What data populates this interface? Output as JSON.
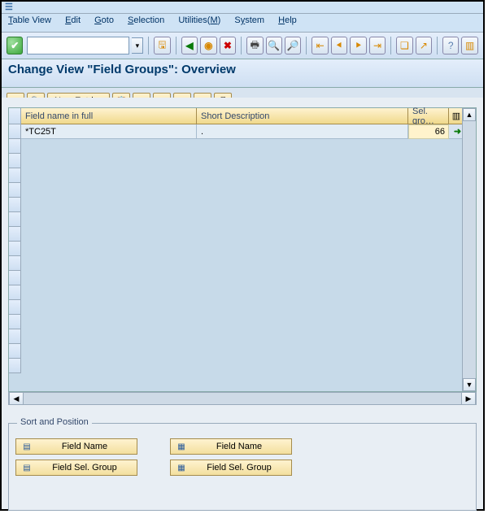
{
  "menu": {
    "table_view": "Table View",
    "edit": "Edit",
    "goto": "Goto",
    "selection": "Selection",
    "utilities": "Utilities(M)",
    "system": "System",
    "help": "Help"
  },
  "page_title": "Change View \"Field Groups\": Overview",
  "app_toolbar": {
    "new_entries": "New Entries"
  },
  "grid": {
    "columns": {
      "field_name": "Field name in full",
      "short_desc": "Short Description",
      "sel_grp": "Sel. gro…"
    },
    "rows": [
      {
        "field_name": "*TC25T",
        "short_desc": ".",
        "sel_grp": "66"
      }
    ]
  },
  "sort_panel": {
    "legend": "Sort and Position",
    "left": {
      "field_name": "Field Name",
      "field_sel_group": "Field Sel. Group"
    },
    "right": {
      "field_name": "Field Name",
      "field_sel_group": "Field Sel. Group"
    }
  }
}
